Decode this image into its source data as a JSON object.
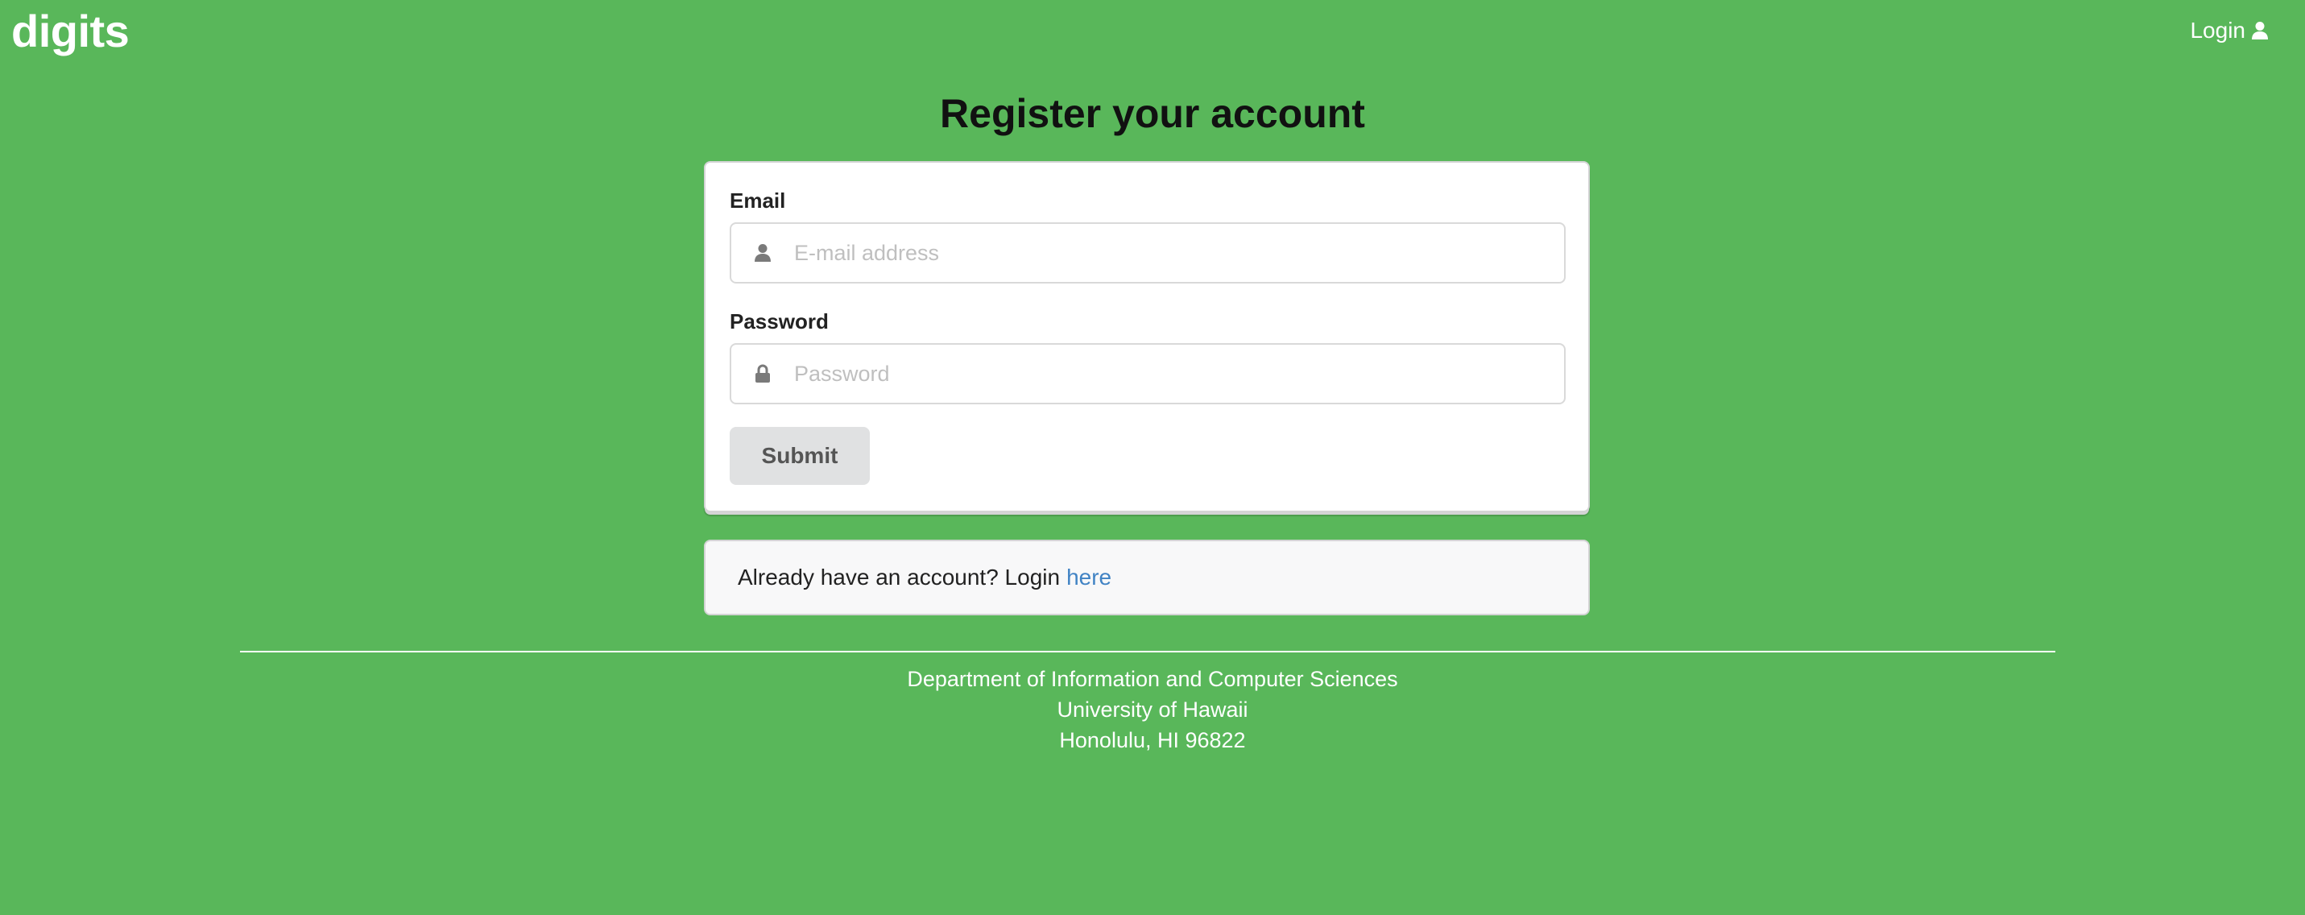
{
  "navbar": {
    "brand": "digits",
    "login_label": "Login",
    "login_icon": "user-icon"
  },
  "page": {
    "title": "Register your account"
  },
  "form": {
    "email_label": "Email",
    "email_placeholder": "E-mail address",
    "email_value": "",
    "email_icon": "user-icon",
    "password_label": "Password",
    "password_placeholder": "Password",
    "password_value": "",
    "password_icon": "lock-icon",
    "submit_label": "Submit"
  },
  "message": {
    "text": "Already have an account? Login",
    "link_label": "here"
  },
  "footer": {
    "line1": "Department of Information and Computer Sciences",
    "line2": "University of Hawaii",
    "line3": "Honolulu, HI 96822"
  },
  "colors": {
    "background": "#59b75a",
    "link": "#4183c4",
    "button": "#e0e1e2"
  }
}
